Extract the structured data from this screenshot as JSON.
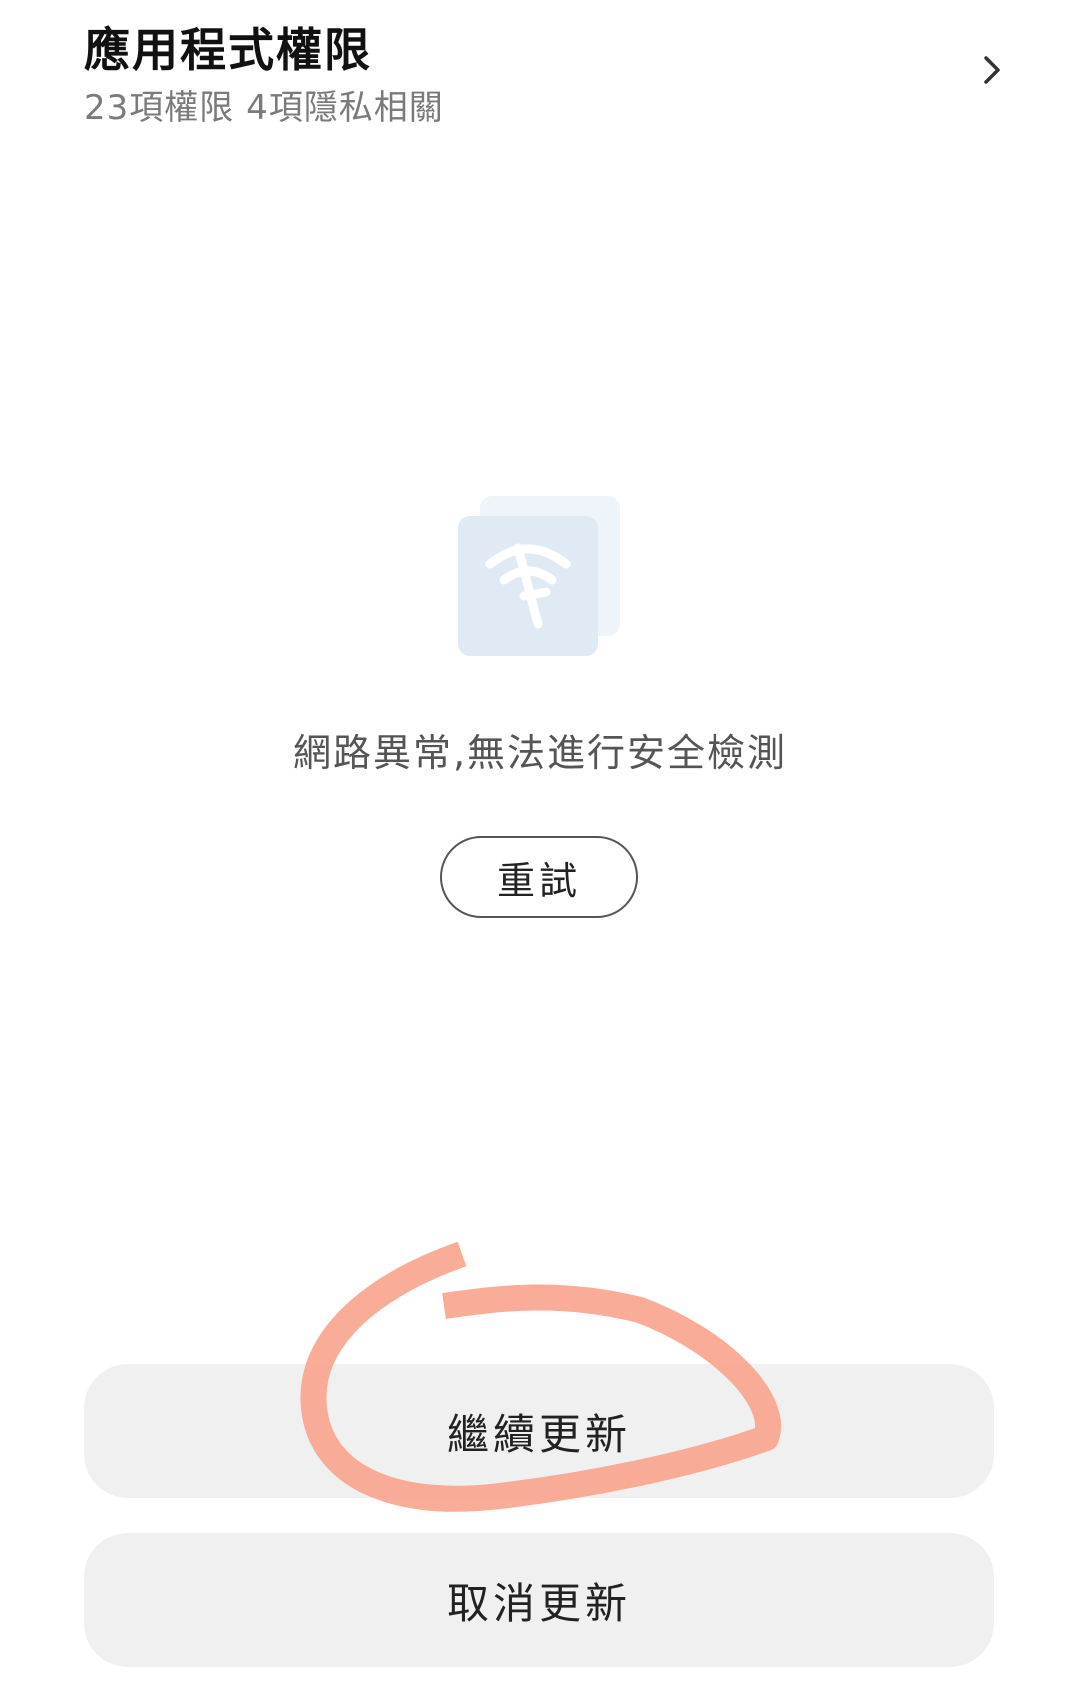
{
  "permissions": {
    "title": "應用程式權限",
    "summary": "23項權限 4項隱私相關",
    "chevron_icon": "chevron-right-icon"
  },
  "status": {
    "illustration_icon": "no-network-icon",
    "message": "網路異常,無法進行安全檢測",
    "retry_label": "重試"
  },
  "actions": {
    "continue_label": "繼續更新",
    "cancel_label": "取消更新"
  },
  "colors": {
    "button_bg": "#f0f0f0",
    "annotation_stroke": "#f9a58f",
    "icon_tint": "#dfeaf4"
  }
}
